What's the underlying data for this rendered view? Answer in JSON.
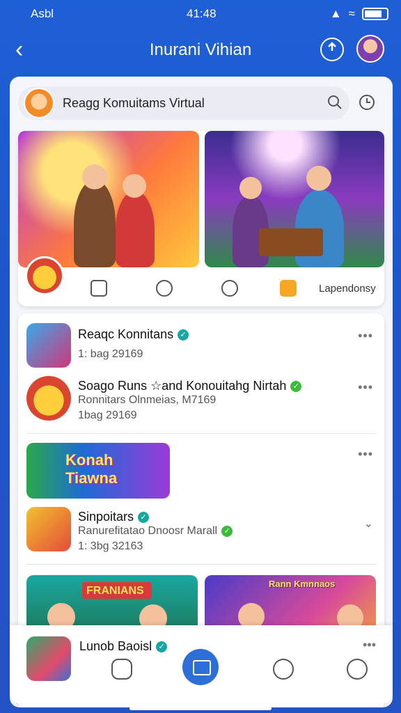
{
  "status_bar": {
    "carrier": "Asbl",
    "time": "41:48"
  },
  "header": {
    "title": "Inurani Vihian"
  },
  "search": {
    "text": "Reagg Komuitams Virtual"
  },
  "featured": {
    "action_label": "Lapendonsy"
  },
  "list": [
    {
      "title": "Reaqc Konnitans",
      "sub1": "1: bag  29169",
      "sub2": ""
    },
    {
      "title": "Soago Runs ☆and Konouitahg Nirtah",
      "sub1": "Ronnitars Olnmeias, M7169",
      "sub2": "1bag  29169"
    },
    {
      "title": "Sinpoitars",
      "sub1": "Ranurefitatao Dnoosr Marall",
      "sub2": "1: 3bg  32163"
    }
  ],
  "banners": {
    "middle": "Konah Tiawna",
    "left_bottom": "FRANIANS",
    "right_bottom": "Rann Kmnnaos"
  },
  "bottom": {
    "title": "Lunob Baoisl"
  },
  "colors": {
    "brand_blue": "#1f5fd6",
    "verified_teal": "#18a6a0",
    "verified_green": "#3cba3c",
    "accent_gold": "#f5a623"
  },
  "icons": [
    "back-arrow-icon",
    "share-icon",
    "search-icon",
    "clock-icon",
    "more-icon",
    "chevron-down-icon",
    "home-icon",
    "profile-icon"
  ]
}
